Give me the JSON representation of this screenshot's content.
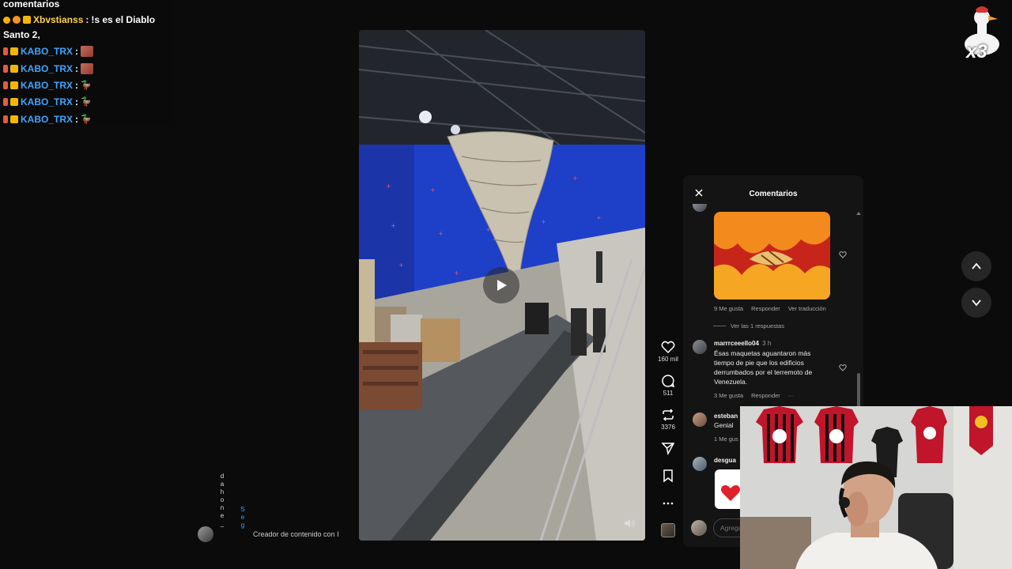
{
  "chat": {
    "title": "comentarios",
    "messages": [
      {
        "user": "Xbvstianss",
        "sep": ":",
        "text": "!s es el Diablo"
      },
      {
        "user": "",
        "sep": "",
        "text": "Santo 2,"
      },
      {
        "user": "KABO_TRX",
        "sep": ":",
        "text": ""
      },
      {
        "user": "KABO_TRX",
        "sep": ":",
        "text": ""
      },
      {
        "user": "KABO_TRX",
        "sep": ":",
        "text": ""
      },
      {
        "user": "KABO_TRX",
        "sep": ":",
        "text": ""
      },
      {
        "user": "KABO_TRX",
        "sep": ":",
        "text": ""
      }
    ]
  },
  "overlay": {
    "duck_badge": "x3"
  },
  "actions": {
    "likes": "160 mil",
    "comments": "511",
    "reposts": "3376"
  },
  "comments_panel": {
    "title": "Comentarios",
    "first": {
      "likes": "9 Me gusta",
      "reply": "Responder",
      "translate": "Ver traducción",
      "view_replies": "Ver las 1 respuestas"
    },
    "second": {
      "user": "marrrceeello04",
      "time": "3 h",
      "text": "Ésas maquetas aguantaron más tiempo de pie que los edificios derrumbados por el terremoto de Venezuela.",
      "likes": "3 Me gusta",
      "reply": "Responder",
      "more": "···"
    },
    "third": {
      "user": "esteban",
      "text": "Genial",
      "likes": "1 Me gus"
    },
    "fourth": {
      "user": "desgua"
    },
    "input_placeholder": "Agrega"
  },
  "creator": {
    "label": "Creador de contenido con I",
    "vertical_left": "dahone_",
    "vertical_right": "Seg"
  },
  "colors": {
    "accent_blue": "#3da5ff",
    "chat_yellow": "#ffd24a",
    "panel_bg": "#141414"
  }
}
